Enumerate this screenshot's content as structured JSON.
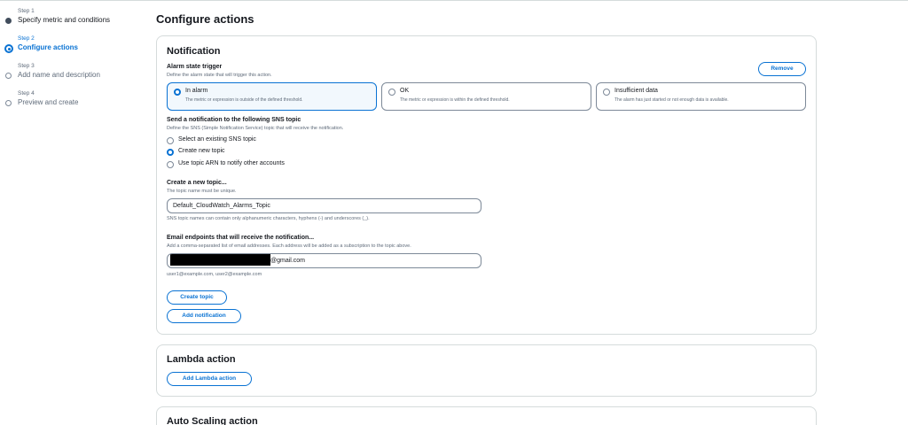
{
  "steps": [
    {
      "label": "Step 1",
      "title": "Specify metric and conditions",
      "state": "done"
    },
    {
      "label": "Step 2",
      "title": "Configure actions",
      "state": "active"
    },
    {
      "label": "Step 3",
      "title": "Add name and description",
      "state": "todo"
    },
    {
      "label": "Step 4",
      "title": "Preview and create",
      "state": "todo"
    }
  ],
  "page": {
    "title": "Configure actions"
  },
  "notification": {
    "heading": "Notification",
    "remove_label": "Remove",
    "trigger": {
      "label": "Alarm state trigger",
      "desc": "Define the alarm state that will trigger this action.",
      "options": [
        {
          "title": "In alarm",
          "desc": "The metric or expression is outside of the defined threshold.",
          "selected": true
        },
        {
          "title": "OK",
          "desc": "The metric or expression is within the defined threshold.",
          "selected": false
        },
        {
          "title": "Insufficient data",
          "desc": "The alarm has just started or not enough data is available.",
          "selected": false
        }
      ]
    },
    "sns": {
      "label": "Send a notification to the following SNS topic",
      "desc": "Define the SNS (Simple Notification Service) topic that will receive the notification.",
      "options": [
        {
          "text": "Select an existing SNS topic",
          "selected": false
        },
        {
          "text": "Create new topic",
          "selected": true
        },
        {
          "text": "Use topic ARN to notify other accounts",
          "selected": false
        }
      ]
    },
    "new_topic": {
      "label": "Create a new topic...",
      "desc": "The topic name must be unique.",
      "value": "Default_CloudWatch_Alarms_Topic",
      "hint": "SNS topic names can contain only alphanumeric characters, hyphens (-) and underscores (_)."
    },
    "email": {
      "label": "Email endpoints that will receive the notification...",
      "desc": "Add a comma-separated list of email addresses. Each address will be added as a subscription to the topic above.",
      "value_suffix": "@gmail.com",
      "hint": "user1@example.com, user2@example.com"
    },
    "create_topic_label": "Create topic",
    "add_notification_label": "Add notification"
  },
  "lambda": {
    "heading": "Lambda action",
    "button": "Add Lambda action"
  },
  "autoscaling": {
    "heading": "Auto Scaling action"
  },
  "colors": {
    "accent": "#0972d3",
    "border": "#d5dbdb",
    "muted": "#5f6b7a"
  }
}
